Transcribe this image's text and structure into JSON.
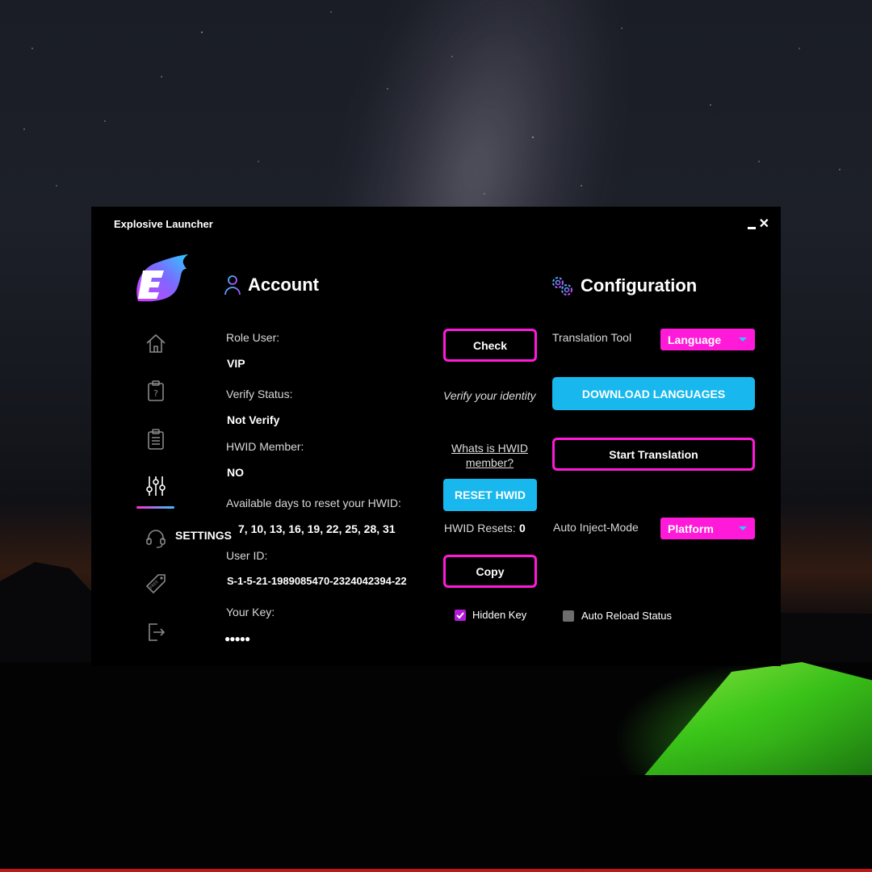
{
  "window": {
    "title": "Explosive Launcher"
  },
  "sidebar": {
    "items": [
      {
        "name": "home-icon"
      },
      {
        "name": "clipboard-question-icon"
      },
      {
        "name": "clipboard-list-icon"
      },
      {
        "name": "sliders-icon",
        "active": true
      },
      {
        "name": "headset-icon",
        "label": "SETTINGS"
      },
      {
        "name": "free-tag-icon",
        "tag_text": "FREE"
      },
      {
        "name": "logout-icon"
      }
    ]
  },
  "account": {
    "title": "Account",
    "role_label": "Role User:",
    "role_value": "VIP",
    "verify_label": "Verify Status:",
    "verify_value": "Not Verify",
    "hwid_member_label": "HWID Member:",
    "hwid_member_value": "NO",
    "reset_days_label": "Available days to reset your HWID:",
    "reset_days_value": "7, 10, 13, 16, 19, 22, 25, 28, 31",
    "user_id_label": "User ID:",
    "user_id_value": "S-1-5-21-1989085470-2324042394-22",
    "key_label": "Your Key:",
    "key_value": "●●●●●"
  },
  "actions": {
    "check_label": "Check",
    "verify_hint": "Verify your identity",
    "hwid_link": "Whats is HWID member?",
    "reset_label": "RESET HWID",
    "hwid_resets_label": "HWID Resets:",
    "hwid_resets_value": "0",
    "copy_label": "Copy",
    "hidden_key_label": "Hidden Key",
    "hidden_key_checked": true
  },
  "config": {
    "title": "Configuration",
    "translation_label": "Translation Tool",
    "translation_select": "Language",
    "download_label": "DOWNLOAD LANGUAGES",
    "start_label": "Start Translation",
    "inject_label": "Auto Inject-Mode",
    "inject_select": "Platform",
    "auto_reload_label": "Auto Reload Status",
    "auto_reload_checked": false
  },
  "colors": {
    "accent_pink": "#ff1ad9",
    "accent_cyan": "#18b8ee",
    "window_bg": "#000000"
  }
}
